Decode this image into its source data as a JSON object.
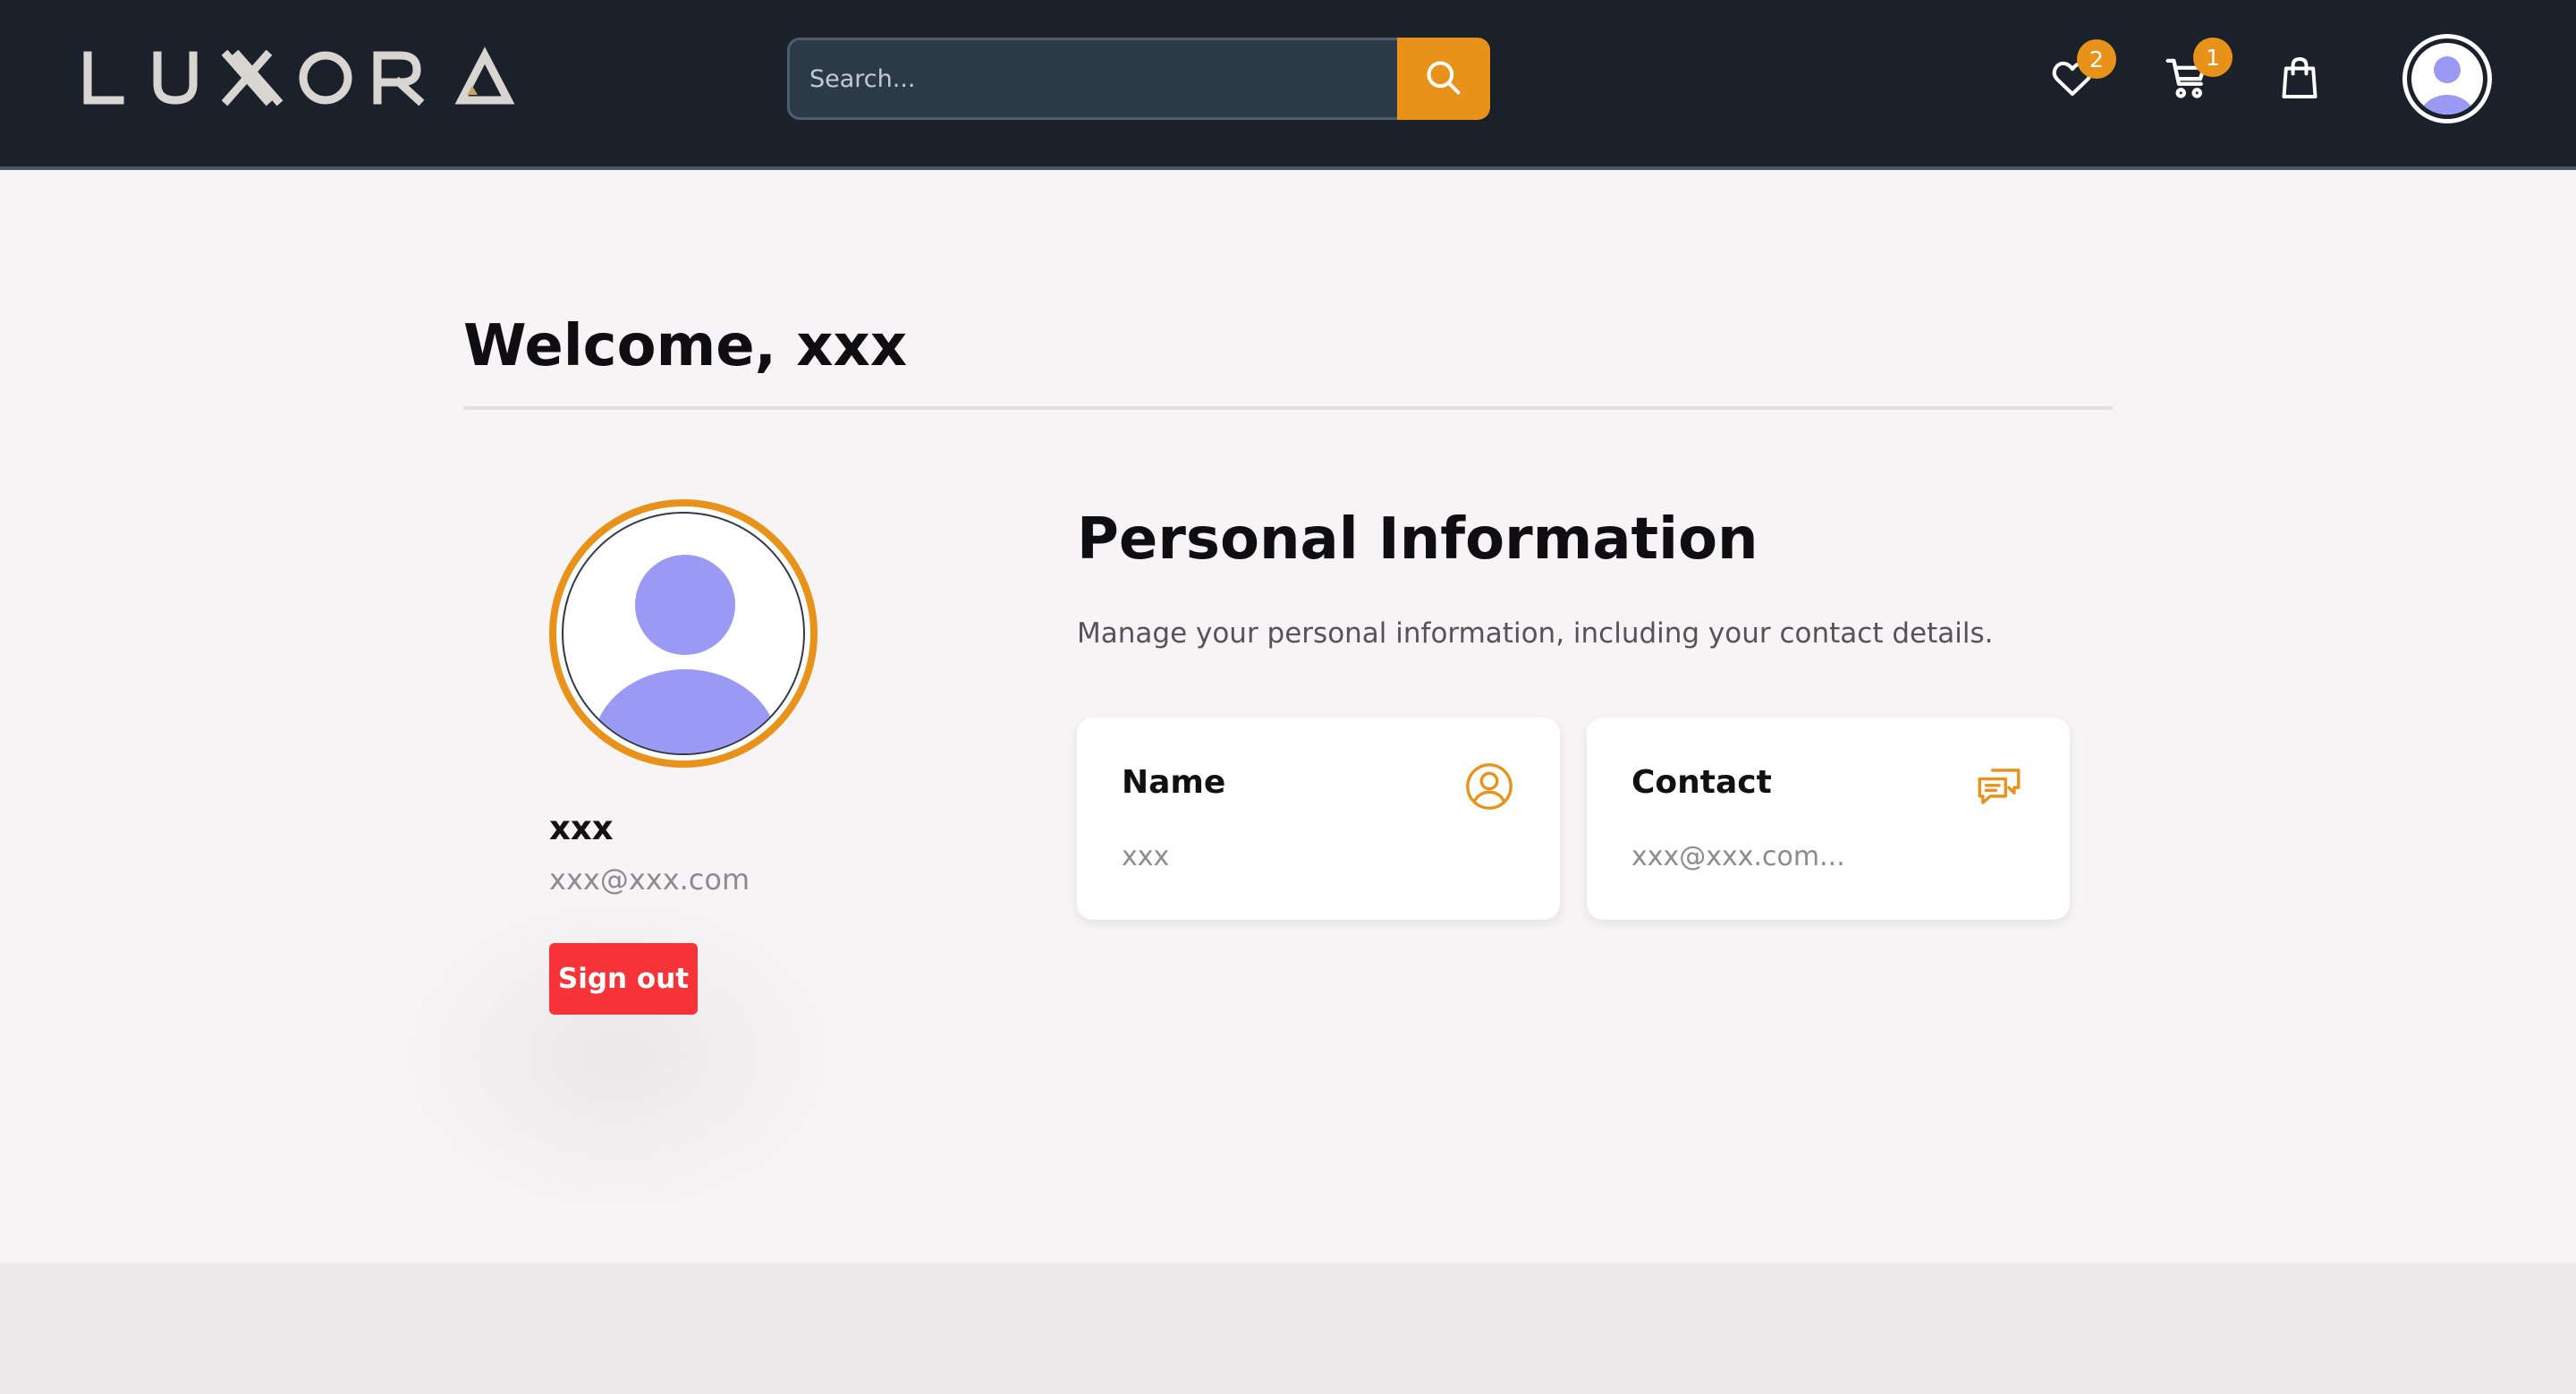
{
  "header": {
    "logo_text": "LUXORA",
    "search": {
      "placeholder": "Search...",
      "value": ""
    },
    "icons": {
      "search": "search-icon",
      "wishlist": "heart-icon",
      "cart": "cart-icon",
      "bag": "shopping-bag-icon",
      "account": "user-avatar-icon"
    },
    "wishlist_count": "2",
    "cart_count": "1"
  },
  "main": {
    "welcome_title": "Welcome, xxx",
    "profile": {
      "name": "xxx",
      "email": "xxx@xxx.com",
      "sign_out_label": "Sign out"
    },
    "personal_info": {
      "title": "Personal Information",
      "subtitle": "Manage your personal information, including your contact details.",
      "cards": [
        {
          "title": "Name",
          "value": "xxx",
          "icon": "user-circle-icon"
        },
        {
          "title": "Contact",
          "value": "xxx@xxx.com...",
          "icon": "chat-bubbles-icon"
        }
      ]
    }
  },
  "colors": {
    "header_bg": "#1b212b",
    "accent": "#e8921a",
    "danger": "#f53339",
    "avatar": "#9a9af5",
    "page_bg": "#f6f4f5"
  }
}
